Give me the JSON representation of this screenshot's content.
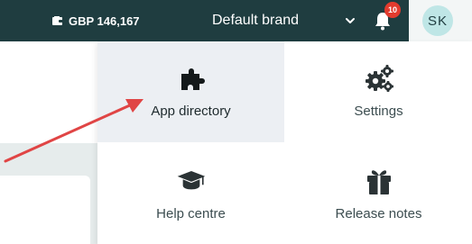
{
  "topbar": {
    "balance": "GBP 146,167",
    "brand": "Default brand",
    "notifications_count": "10",
    "avatar_initials": "SK"
  },
  "menu": {
    "items": [
      {
        "label": "App directory",
        "icon": "puzzle-icon",
        "active": true
      },
      {
        "label": "Settings",
        "icon": "gears-icon",
        "active": false
      },
      {
        "label": "Help centre",
        "icon": "graduation-cap-icon",
        "active": false
      },
      {
        "label": "Release notes",
        "icon": "gift-icon",
        "active": false
      }
    ]
  },
  "colors": {
    "topbar_bg": "#1f3d40",
    "badge": "#e23b2e",
    "avatar_bg": "#bfe6e6",
    "active_tile": "#eceff3",
    "annotation_arrow": "#e04545"
  }
}
